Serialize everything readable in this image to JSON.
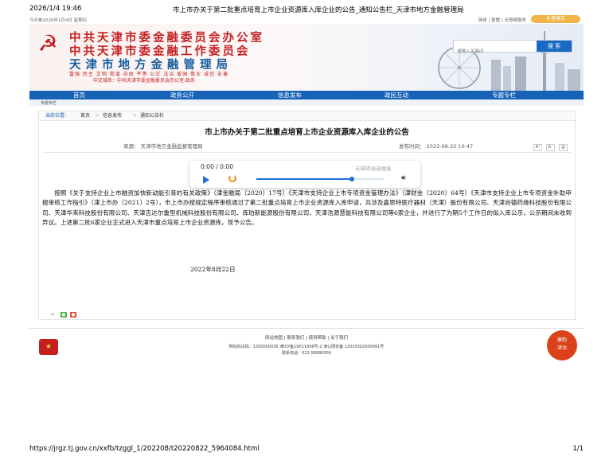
{
  "print": {
    "datetime": "2026/1/4 19:46",
    "doc_title": "市上市办关于第二批重点培育上市企业资源库入库企业的公告_通知公告栏_天津市地方金融管理局",
    "url": "https://jrgz.tj.gov.cn/xxfb/tzggl_1/202208/t20220822_5964084.html",
    "page": "1/1"
  },
  "topbar": {
    "today": "今天是2026年1月4日  星期日",
    "links": "简体  |  繁體  |  无障碍服务",
    "care_mode": "长者模式"
  },
  "banner": {
    "line1": "中共天津市委金融委员会办公室",
    "line2": "中共天津市委金融工作委员会",
    "line3": "天津市地方金融管理局",
    "values": "富强 民主 文明 和谐 自由 平等 公正 法治 爱国 敬业 诚信 友善",
    "domain": "中文域名：中共天津市委金融委员会办公室.政务",
    "search_placeholder": "请输入关键词",
    "search_button": "搜 索"
  },
  "nav": [
    "首页",
    "政务公开",
    "信息发布",
    "政民互动",
    "专题专栏"
  ],
  "subnav": "专题专栏",
  "breadcrumb": {
    "label": "当前位置：",
    "items": [
      "首页",
      "信息发布",
      "通知公告栏"
    ],
    "sep": "＞"
  },
  "article": {
    "title": "市上市办关于第二批重点培育上市企业资源库入库企业的公告",
    "source": "来源：  天津市地方金融监督管理局",
    "published": "发布时间：  2022-08-22 10:47",
    "font_controls": [
      "A⁺",
      "A⁻",
      "⎙"
    ],
    "body": "按照《关于支持企业上市融资加快新动能引育的有关政策》（津金融局〔2020〕17号）《天津市支持企业上市专项资金管理办法》（津财金〔2020〕64号）《天津市支持企业上市专项资金补助申报审核工作指引》（津上市办〔2021〕2号），市上市办按规定程序审核通过了第二批重点培育上市企业资源库入库申请，共涉及嘉思特医疗器材（天津）股份有限公司、天津尚德药缘科技股份有限公司、天津华来科技股份有限公司、天津吉达尔重型机械科技股份有限公司、库珀新能源股份有限公司、天津浩源慧能科技有限公司等6家企业，并进行了为期5个工作日的拟入库公示，公示期间未收到异议。上述第二批6家企业正式进入天津市重点培育上市企业资源库，现予公告。",
    "date": "2022年8月22日"
  },
  "player": {
    "time": "0:00 / 0:00",
    "label": "无障碍语音播报",
    "progress": 0.75
  },
  "share_icons": [
    "share-icon",
    "wechat-icon",
    "weibo-icon"
  ],
  "footer": {
    "links": "网站地图  |  联系我们  |  使用帮助  |  关于我们",
    "license": "网站标识码：1200000036  津ICP备19011956号-2  津公网安备 12010302000991号",
    "tel": "联系电话：022-58980006",
    "seal": "廉韵津沽"
  },
  "colors": {
    "red": "#c51f1f",
    "blue_nav": "#1662b7",
    "accent_orange": "#f0b64a"
  }
}
